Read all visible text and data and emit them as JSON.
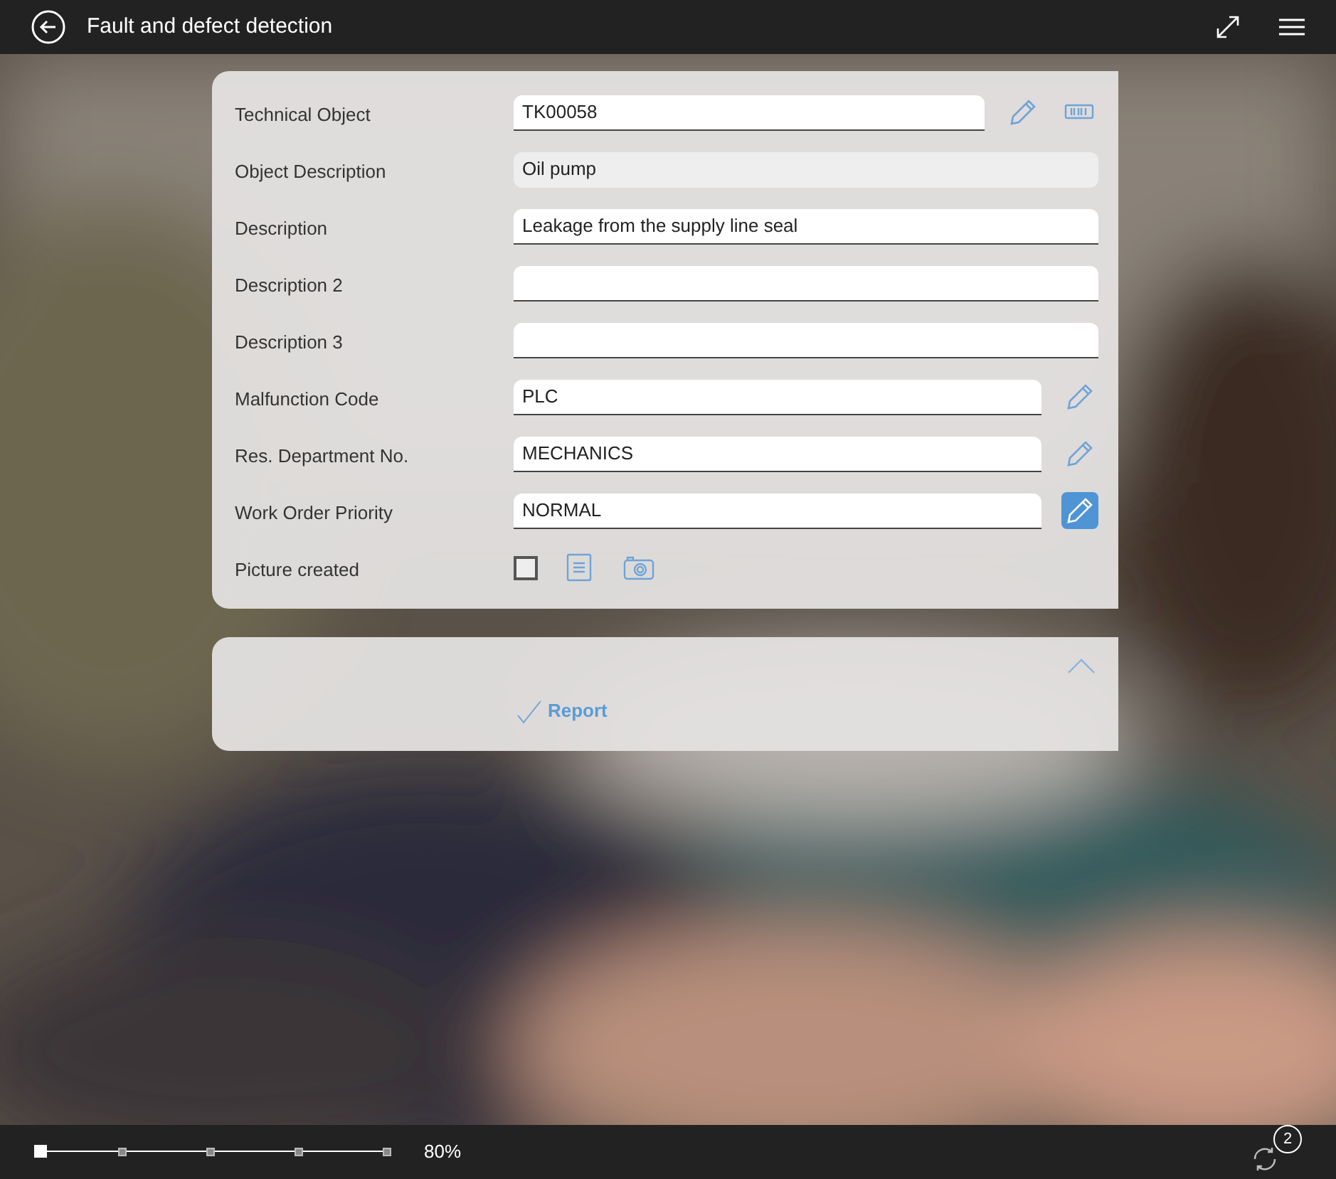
{
  "window": {
    "title": "Fault and defect detection"
  },
  "fields": [
    {
      "label": "Technical Object",
      "kind": "text",
      "value": "TK00058",
      "tools": [
        {
          "kind": "pencil",
          "highlighted": false
        },
        {
          "kind": "barcode",
          "highlighted": false
        }
      ]
    },
    {
      "label": "Object Description",
      "kind": "readonly",
      "value": "Oil pump"
    },
    {
      "label": "Description",
      "kind": "text",
      "value": "Leakage from the supply line seal"
    },
    {
      "label": "Description 2",
      "kind": "text"
    },
    {
      "label": "Description 3",
      "kind": "text"
    },
    {
      "label": "Malfunction Code",
      "kind": "text",
      "value": "PLC",
      "tools": [
        {
          "kind": "pencil",
          "highlighted": false
        }
      ]
    },
    {
      "label": "Res. Department No.",
      "kind": "text",
      "value": "MECHANICS",
      "tools": [
        {
          "kind": "pencil",
          "highlighted": false
        }
      ]
    },
    {
      "label": "Work Order Priority",
      "kind": "text",
      "value": "NORMAL",
      "tools": [
        {
          "kind": "pencil",
          "highlighted": true
        }
      ]
    },
    {
      "label": "Picture created",
      "kind": "checkbox",
      "checked": false,
      "tools": [
        {
          "kind": "list",
          "highlighted": false
        },
        {
          "kind": "camera",
          "highlighted": false
        }
      ]
    }
  ],
  "actions": {
    "expanded": true,
    "report": "Report"
  },
  "zoom": {
    "level": 0,
    "reading": "80%"
  },
  "sync": {
    "badge": "2"
  }
}
